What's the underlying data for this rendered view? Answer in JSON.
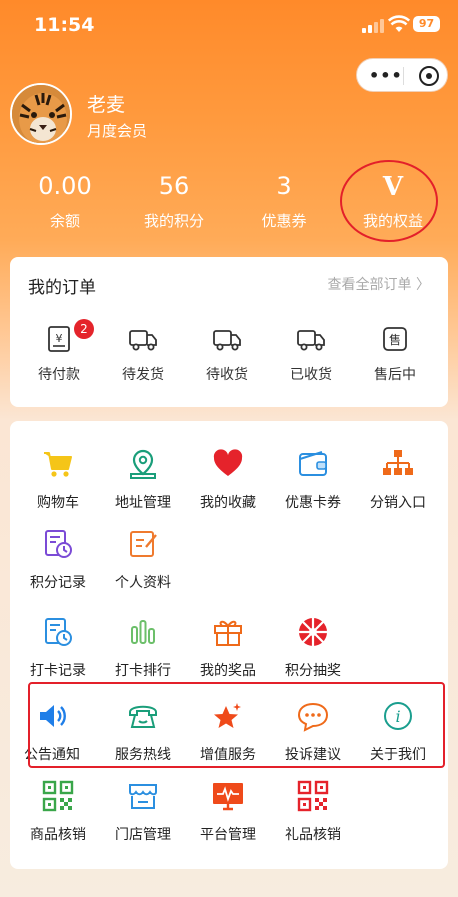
{
  "status": {
    "time": "11:54",
    "battery": "97"
  },
  "profile": {
    "name": "老麦",
    "level": "月度会员"
  },
  "stats": [
    {
      "value": "0.00",
      "label": "余额"
    },
    {
      "value": "56",
      "label": "我的积分"
    },
    {
      "value": "3",
      "label": "优惠券"
    },
    {
      "value": "V",
      "label": "我的权益"
    }
  ],
  "orders": {
    "title": "我的订单",
    "view_all": "查看全部订单 〉",
    "items": [
      {
        "label": "待付款",
        "badge": "2",
        "icon": "receipt-yen-icon"
      },
      {
        "label": "待发货",
        "icon": "truck-icon"
      },
      {
        "label": "待收货",
        "icon": "truck-icon"
      },
      {
        "label": "已收货",
        "icon": "truck-icon"
      },
      {
        "label": "售后中",
        "icon": "after-sale-icon"
      }
    ]
  },
  "services": {
    "row1": [
      {
        "label": "购物车",
        "icon": "cart-icon",
        "color": "#f5c518"
      },
      {
        "label": "地址管理",
        "icon": "location-pin-icon",
        "color": "#1a9e7a"
      },
      {
        "label": "我的收藏",
        "icon": "heart-icon",
        "color": "#e5232b"
      },
      {
        "label": "优惠卡券",
        "icon": "wallet-icon",
        "color": "#2b8fe0"
      },
      {
        "label": "分销入口",
        "icon": "org-chart-icon",
        "color": "#ef6a1a"
      }
    ],
    "row2": [
      {
        "label": "积分记录",
        "icon": "doc-clock-icon",
        "color": "#7b4bd6"
      },
      {
        "label": "个人资料",
        "icon": "edit-doc-icon",
        "color": "#ef7a2e"
      }
    ],
    "row3": [
      {
        "label": "打卡记录",
        "icon": "doc-clock-icon",
        "color": "#2b8fe0"
      },
      {
        "label": "打卡排行",
        "icon": "bar-chart-icon",
        "color": "#6cbf6a"
      },
      {
        "label": "我的奖品",
        "icon": "gift-icon",
        "color": "#ef6a1a"
      },
      {
        "label": "积分抽奖",
        "icon": "lottery-wheel-icon",
        "color": "#e5232b"
      }
    ],
    "row4": [
      {
        "label": "公告通知",
        "icon": "speaker-icon",
        "color": "#1f7ee8"
      },
      {
        "label": "服务热线",
        "icon": "phone-icon",
        "color": "#1a9e7a"
      },
      {
        "label": "增值服务",
        "icon": "star-icon",
        "color": "#ef4a1a"
      },
      {
        "label": "投诉建议",
        "icon": "chat-bubble-icon",
        "color": "#ef6a1a"
      },
      {
        "label": "关于我们",
        "icon": "info-icon",
        "color": "#1a9e8e"
      }
    ],
    "row5": [
      {
        "label": "商品核销",
        "icon": "qr-code-icon",
        "color": "#3aa64a"
      },
      {
        "label": "门店管理",
        "icon": "store-icon",
        "color": "#2b8fe0"
      },
      {
        "label": "平台管理",
        "icon": "monitor-icon",
        "color": "#ef4a1a"
      },
      {
        "label": "礼品核销",
        "icon": "qr-code-icon",
        "color": "#e5232b"
      }
    ]
  }
}
